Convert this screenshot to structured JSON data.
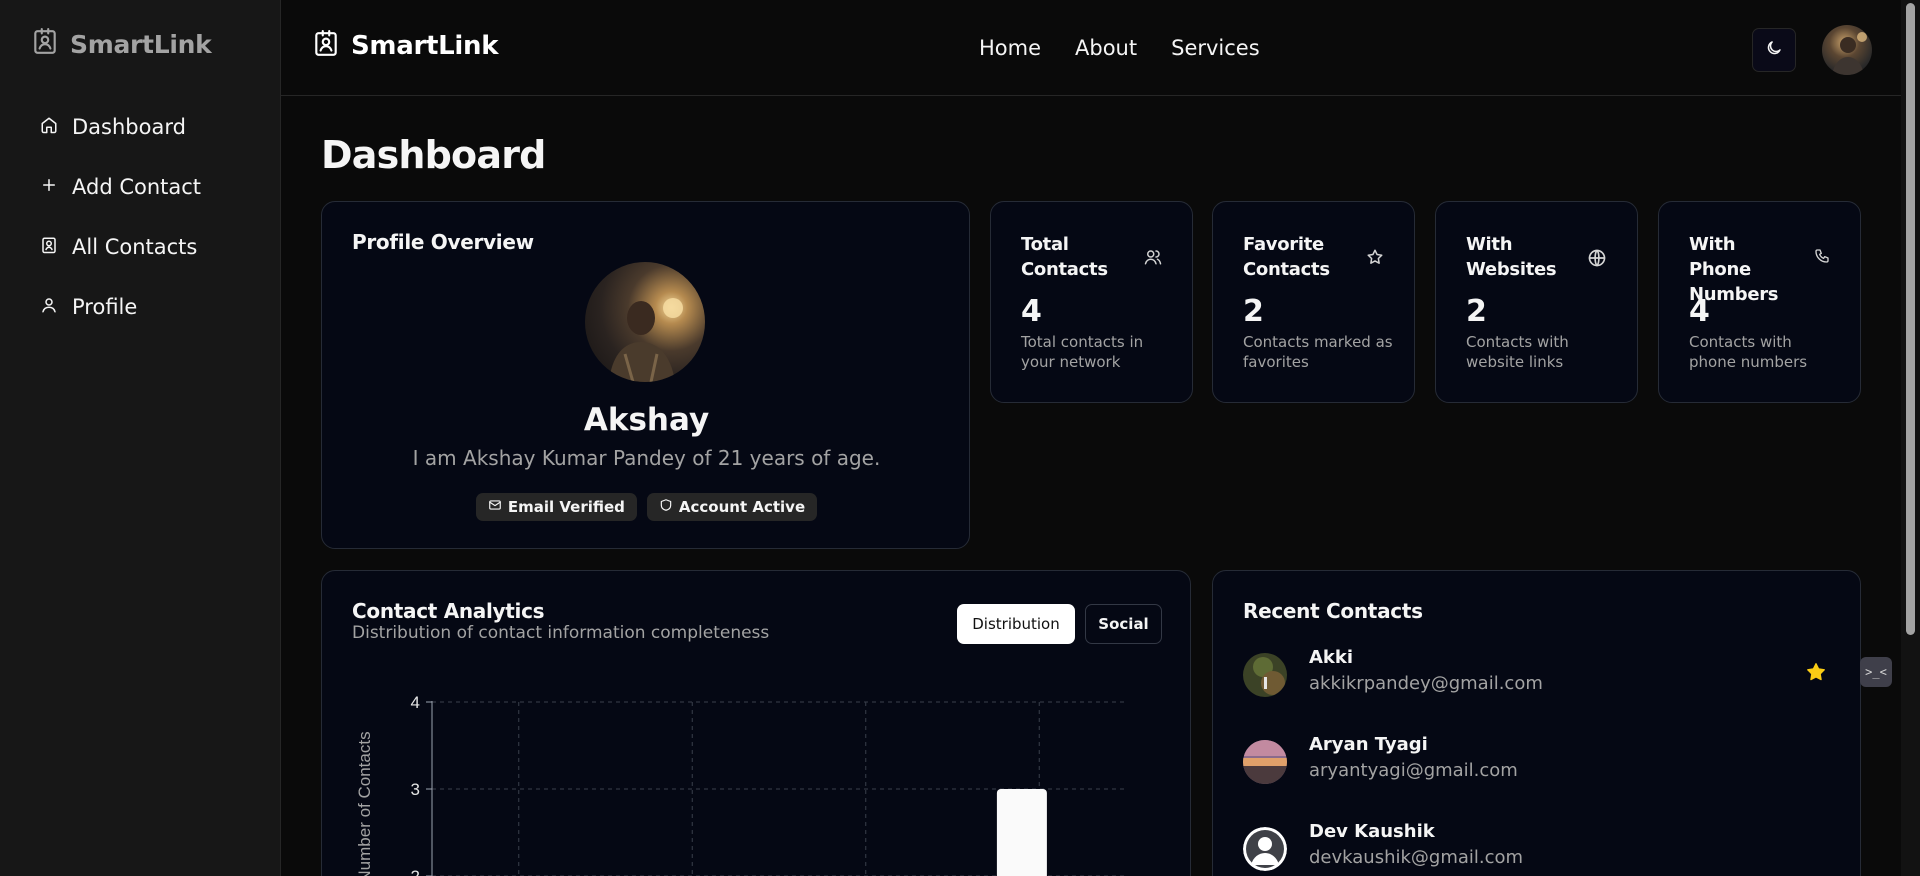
{
  "app": {
    "brand": "SmartLink"
  },
  "sidebar": {
    "items": [
      {
        "label": "Dashboard",
        "icon": "home-icon"
      },
      {
        "label": "Add Contact",
        "icon": "plus-icon"
      },
      {
        "label": "All Contacts",
        "icon": "contacts-book-icon"
      },
      {
        "label": "Profile",
        "icon": "user-icon"
      }
    ]
  },
  "header": {
    "nav": [
      "Home",
      "About",
      "Services"
    ],
    "theme_icon": "moon-icon"
  },
  "page": {
    "title": "Dashboard"
  },
  "profile": {
    "title": "Profile Overview",
    "name": "Akshay",
    "bio": "I am Akshay Kumar Pandey of 21 years of age.",
    "badges": [
      {
        "label": "Email Verified",
        "icon": "mail-icon"
      },
      {
        "label": "Account Active",
        "icon": "shield-icon"
      }
    ]
  },
  "stats": [
    {
      "title": "Total Contacts",
      "value": "4",
      "desc": "Total contacts in your network",
      "icon": "users-icon"
    },
    {
      "title": "Favorite Contacts",
      "value": "2",
      "desc": "Contacts marked as favorites",
      "icon": "star-icon"
    },
    {
      "title": "With Websites",
      "value": "2",
      "desc": "Contacts with website links",
      "icon": "globe-icon"
    },
    {
      "title": "With Phone Numbers",
      "value": "4",
      "desc": "Contacts with phone numbers",
      "icon": "phone-icon"
    }
  ],
  "analytics": {
    "title": "Contact Analytics",
    "subtitle": "Distribution of contact information completeness",
    "tabs": [
      "Distribution",
      "Social"
    ],
    "active_tab": "Distribution"
  },
  "chart_data": {
    "type": "bar",
    "ylabel": "Number of Contacts",
    "ylim": [
      0,
      4
    ],
    "y_ticks_visible": [
      "4",
      "3",
      "2"
    ],
    "grid": true,
    "visible_bars": [
      {
        "slot": 3,
        "value": 3
      }
    ],
    "note_visible_only": true
  },
  "recent": {
    "title": "Recent Contacts",
    "items": [
      {
        "name": "Akki",
        "email": "akkikrpandey@gmail.com",
        "favorite": true
      },
      {
        "name": "Aryan Tyagi",
        "email": "aryantyagi@gmail.com",
        "favorite": false
      },
      {
        "name": "Dev Kaushik",
        "email": "devkaushik@gmail.com",
        "favorite": false
      }
    ]
  },
  "widget": {
    "label": ">_<"
  },
  "colors": {
    "background": "#0a0a0a",
    "card": "#050814",
    "border": "#262b36",
    "muted_text": "#a3a3a3",
    "favorite_star": "#facc15"
  }
}
